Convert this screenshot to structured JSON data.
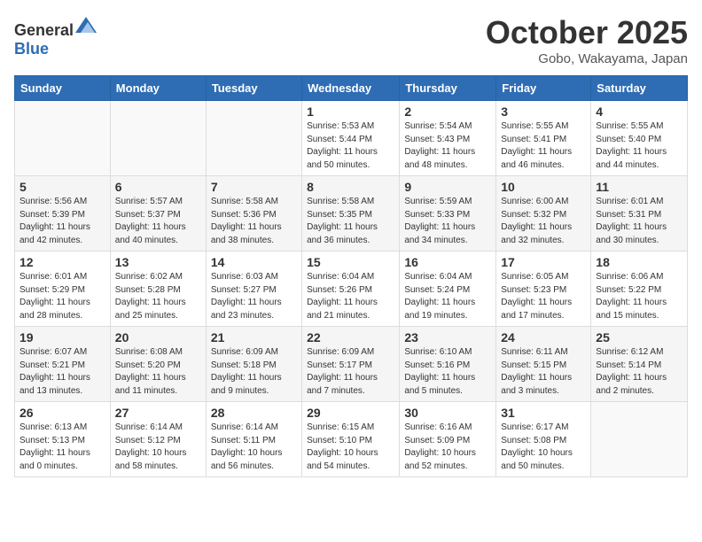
{
  "header": {
    "logo_general": "General",
    "logo_blue": "Blue",
    "month": "October 2025",
    "location": "Gobo, Wakayama, Japan"
  },
  "weekdays": [
    "Sunday",
    "Monday",
    "Tuesday",
    "Wednesday",
    "Thursday",
    "Friday",
    "Saturday"
  ],
  "weeks": [
    [
      {
        "day": "",
        "info": ""
      },
      {
        "day": "",
        "info": ""
      },
      {
        "day": "",
        "info": ""
      },
      {
        "day": "1",
        "info": "Sunrise: 5:53 AM\nSunset: 5:44 PM\nDaylight: 11 hours\nand 50 minutes."
      },
      {
        "day": "2",
        "info": "Sunrise: 5:54 AM\nSunset: 5:43 PM\nDaylight: 11 hours\nand 48 minutes."
      },
      {
        "day": "3",
        "info": "Sunrise: 5:55 AM\nSunset: 5:41 PM\nDaylight: 11 hours\nand 46 minutes."
      },
      {
        "day": "4",
        "info": "Sunrise: 5:55 AM\nSunset: 5:40 PM\nDaylight: 11 hours\nand 44 minutes."
      }
    ],
    [
      {
        "day": "5",
        "info": "Sunrise: 5:56 AM\nSunset: 5:39 PM\nDaylight: 11 hours\nand 42 minutes."
      },
      {
        "day": "6",
        "info": "Sunrise: 5:57 AM\nSunset: 5:37 PM\nDaylight: 11 hours\nand 40 minutes."
      },
      {
        "day": "7",
        "info": "Sunrise: 5:58 AM\nSunset: 5:36 PM\nDaylight: 11 hours\nand 38 minutes."
      },
      {
        "day": "8",
        "info": "Sunrise: 5:58 AM\nSunset: 5:35 PM\nDaylight: 11 hours\nand 36 minutes."
      },
      {
        "day": "9",
        "info": "Sunrise: 5:59 AM\nSunset: 5:33 PM\nDaylight: 11 hours\nand 34 minutes."
      },
      {
        "day": "10",
        "info": "Sunrise: 6:00 AM\nSunset: 5:32 PM\nDaylight: 11 hours\nand 32 minutes."
      },
      {
        "day": "11",
        "info": "Sunrise: 6:01 AM\nSunset: 5:31 PM\nDaylight: 11 hours\nand 30 minutes."
      }
    ],
    [
      {
        "day": "12",
        "info": "Sunrise: 6:01 AM\nSunset: 5:29 PM\nDaylight: 11 hours\nand 28 minutes."
      },
      {
        "day": "13",
        "info": "Sunrise: 6:02 AM\nSunset: 5:28 PM\nDaylight: 11 hours\nand 25 minutes."
      },
      {
        "day": "14",
        "info": "Sunrise: 6:03 AM\nSunset: 5:27 PM\nDaylight: 11 hours\nand 23 minutes."
      },
      {
        "day": "15",
        "info": "Sunrise: 6:04 AM\nSunset: 5:26 PM\nDaylight: 11 hours\nand 21 minutes."
      },
      {
        "day": "16",
        "info": "Sunrise: 6:04 AM\nSunset: 5:24 PM\nDaylight: 11 hours\nand 19 minutes."
      },
      {
        "day": "17",
        "info": "Sunrise: 6:05 AM\nSunset: 5:23 PM\nDaylight: 11 hours\nand 17 minutes."
      },
      {
        "day": "18",
        "info": "Sunrise: 6:06 AM\nSunset: 5:22 PM\nDaylight: 11 hours\nand 15 minutes."
      }
    ],
    [
      {
        "day": "19",
        "info": "Sunrise: 6:07 AM\nSunset: 5:21 PM\nDaylight: 11 hours\nand 13 minutes."
      },
      {
        "day": "20",
        "info": "Sunrise: 6:08 AM\nSunset: 5:20 PM\nDaylight: 11 hours\nand 11 minutes."
      },
      {
        "day": "21",
        "info": "Sunrise: 6:09 AM\nSunset: 5:18 PM\nDaylight: 11 hours\nand 9 minutes."
      },
      {
        "day": "22",
        "info": "Sunrise: 6:09 AM\nSunset: 5:17 PM\nDaylight: 11 hours\nand 7 minutes."
      },
      {
        "day": "23",
        "info": "Sunrise: 6:10 AM\nSunset: 5:16 PM\nDaylight: 11 hours\nand 5 minutes."
      },
      {
        "day": "24",
        "info": "Sunrise: 6:11 AM\nSunset: 5:15 PM\nDaylight: 11 hours\nand 3 minutes."
      },
      {
        "day": "25",
        "info": "Sunrise: 6:12 AM\nSunset: 5:14 PM\nDaylight: 11 hours\nand 2 minutes."
      }
    ],
    [
      {
        "day": "26",
        "info": "Sunrise: 6:13 AM\nSunset: 5:13 PM\nDaylight: 11 hours\nand 0 minutes."
      },
      {
        "day": "27",
        "info": "Sunrise: 6:14 AM\nSunset: 5:12 PM\nDaylight: 10 hours\nand 58 minutes."
      },
      {
        "day": "28",
        "info": "Sunrise: 6:14 AM\nSunset: 5:11 PM\nDaylight: 10 hours\nand 56 minutes."
      },
      {
        "day": "29",
        "info": "Sunrise: 6:15 AM\nSunset: 5:10 PM\nDaylight: 10 hours\nand 54 minutes."
      },
      {
        "day": "30",
        "info": "Sunrise: 6:16 AM\nSunset: 5:09 PM\nDaylight: 10 hours\nand 52 minutes."
      },
      {
        "day": "31",
        "info": "Sunrise: 6:17 AM\nSunset: 5:08 PM\nDaylight: 10 hours\nand 50 minutes."
      },
      {
        "day": "",
        "info": ""
      }
    ]
  ]
}
